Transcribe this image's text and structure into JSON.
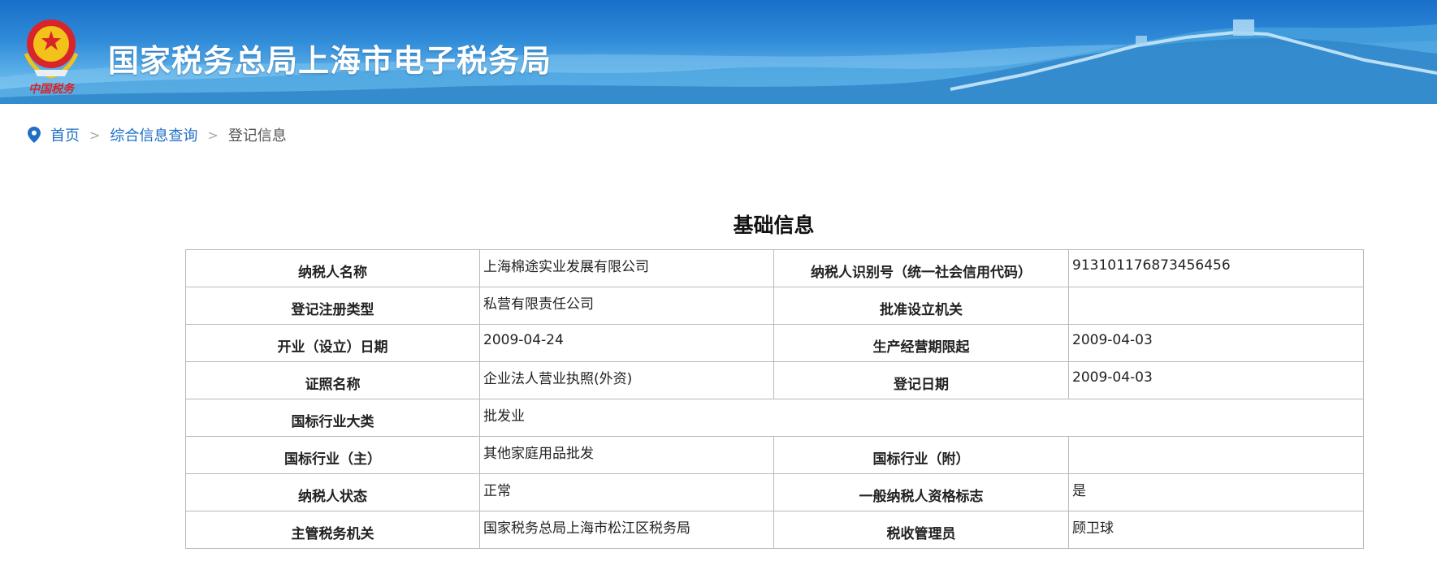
{
  "header": {
    "site_title": "国家税务总局上海市电子税务局",
    "emblem_text": "中国税务",
    "emblem_icon": "tax-emblem-icon",
    "colors": {
      "banner_top": "#1a6fc9",
      "banner_bottom": "#8fd0f4"
    }
  },
  "breadcrumb": {
    "icon": "location-pin-icon",
    "items": [
      "首页",
      "综合信息查询"
    ],
    "separator": ">",
    "current": "登记信息",
    "link_color": "#1f6fc5"
  },
  "section": {
    "title": "基础信息"
  },
  "table": {
    "rows": [
      {
        "label1": "纳税人名称",
        "value1": "上海棉途实业发展有限公司",
        "label2": "纳税人识别号（统一社会信用代码）",
        "value2": "913101176873456456"
      },
      {
        "label1": "登记注册类型",
        "value1": "私营有限责任公司",
        "label2": "批准设立机关",
        "value2": ""
      },
      {
        "label1": "开业（设立）日期",
        "value1": "2009-04-24",
        "label2": "生产经营期限起",
        "value2": "2009-04-03"
      },
      {
        "label1": "证照名称",
        "value1": "企业法人营业执照(外资)",
        "label2": "登记日期",
        "value2": "2009-04-03"
      },
      {
        "label1": "国标行业大类",
        "value1": "批发业"
      },
      {
        "label1": "国标行业（主）",
        "value1": "其他家庭用品批发",
        "label2": "国标行业（附）",
        "value2": ""
      },
      {
        "label1": "纳税人状态",
        "value1": "正常",
        "label2": "一般纳税人资格标志",
        "value2": "是"
      },
      {
        "label1": "主管税务机关",
        "value1": "国家税务总局上海市松江区税务局",
        "label2": "税收管理员",
        "value2": "顾卫球"
      }
    ]
  }
}
